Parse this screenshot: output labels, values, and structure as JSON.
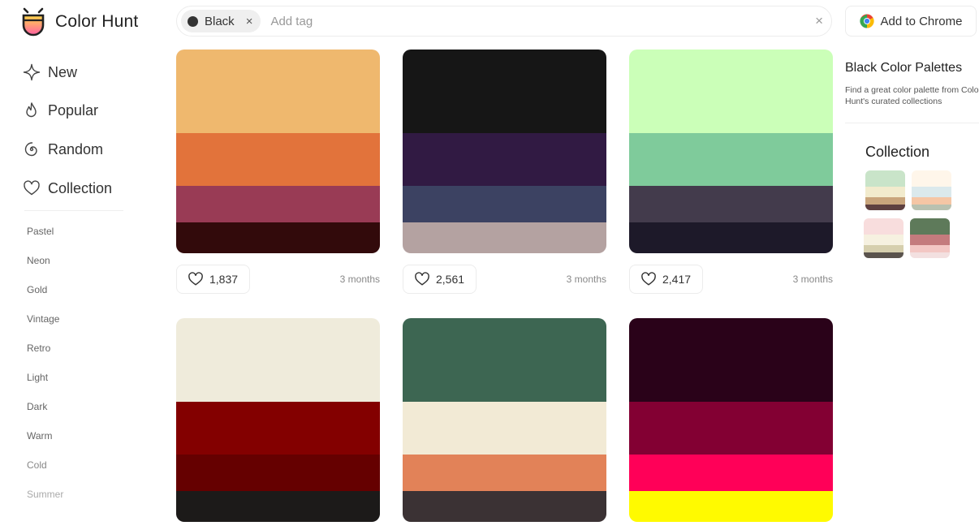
{
  "brand": {
    "name": "Color Hunt"
  },
  "search": {
    "tag": "Black",
    "tag_color": "#333333",
    "remove_icon": "×",
    "placeholder": "Add tag",
    "clear_icon": "×"
  },
  "chrome_button": {
    "label": "Add to Chrome"
  },
  "nav": [
    {
      "label": "New",
      "icon": "sparkle-icon"
    },
    {
      "label": "Popular",
      "icon": "flame-icon"
    },
    {
      "label": "Random",
      "icon": "swirl-icon"
    },
    {
      "label": "Collection",
      "icon": "heart-icon"
    }
  ],
  "tags": [
    "Pastel",
    "Neon",
    "Gold",
    "Vintage",
    "Retro",
    "Light",
    "Dark",
    "Warm",
    "Cold",
    "Summer"
  ],
  "palettes": [
    {
      "colors": [
        "#efb86e",
        "#e2733b",
        "#993b55",
        "#320a0b"
      ],
      "likes": "1,837",
      "age": "3 months"
    },
    {
      "colors": [
        "#161616",
        "#311a43",
        "#3c4262",
        "#b4a2a1"
      ],
      "likes": "2,561",
      "age": "3 months"
    },
    {
      "colors": [
        "#cbffb8",
        "#7fcb9b",
        "#433b4c",
        "#1d1929"
      ],
      "likes": "2,417",
      "age": "3 months"
    },
    {
      "colors": [
        "#efebdb",
        "#830000",
        "#650000",
        "#1c1a19"
      ],
      "likes": "",
      "age": ""
    },
    {
      "colors": [
        "#3d6652",
        "#f2ead5",
        "#e28258",
        "#3b3234"
      ],
      "likes": "",
      "age": ""
    },
    {
      "colors": [
        "#2a0219",
        "#830033",
        "#ff0058",
        "#fffa00"
      ],
      "likes": "",
      "age": ""
    }
  ],
  "right_panel": {
    "title": "Black Color Palettes",
    "description": "Find a great color palette from Color Hunt's curated collections"
  },
  "collection": {
    "title": "Collection",
    "items": [
      {
        "colors": [
          "#c9e4c9",
          "#f2ebcd",
          "#c9a57c",
          "#5e4040"
        ]
      },
      {
        "colors": [
          "#fff6ea",
          "#dbe9ec",
          "#f5c6a5",
          "#b9c1b0"
        ]
      },
      {
        "colors": [
          "#f8dddd",
          "#f6f1e0",
          "#d6cfae",
          "#5a534d"
        ]
      },
      {
        "colors": [
          "#5e7a5a",
          "#c47b7d",
          "#f3c7c4",
          "#f3e0e0"
        ]
      }
    ]
  }
}
